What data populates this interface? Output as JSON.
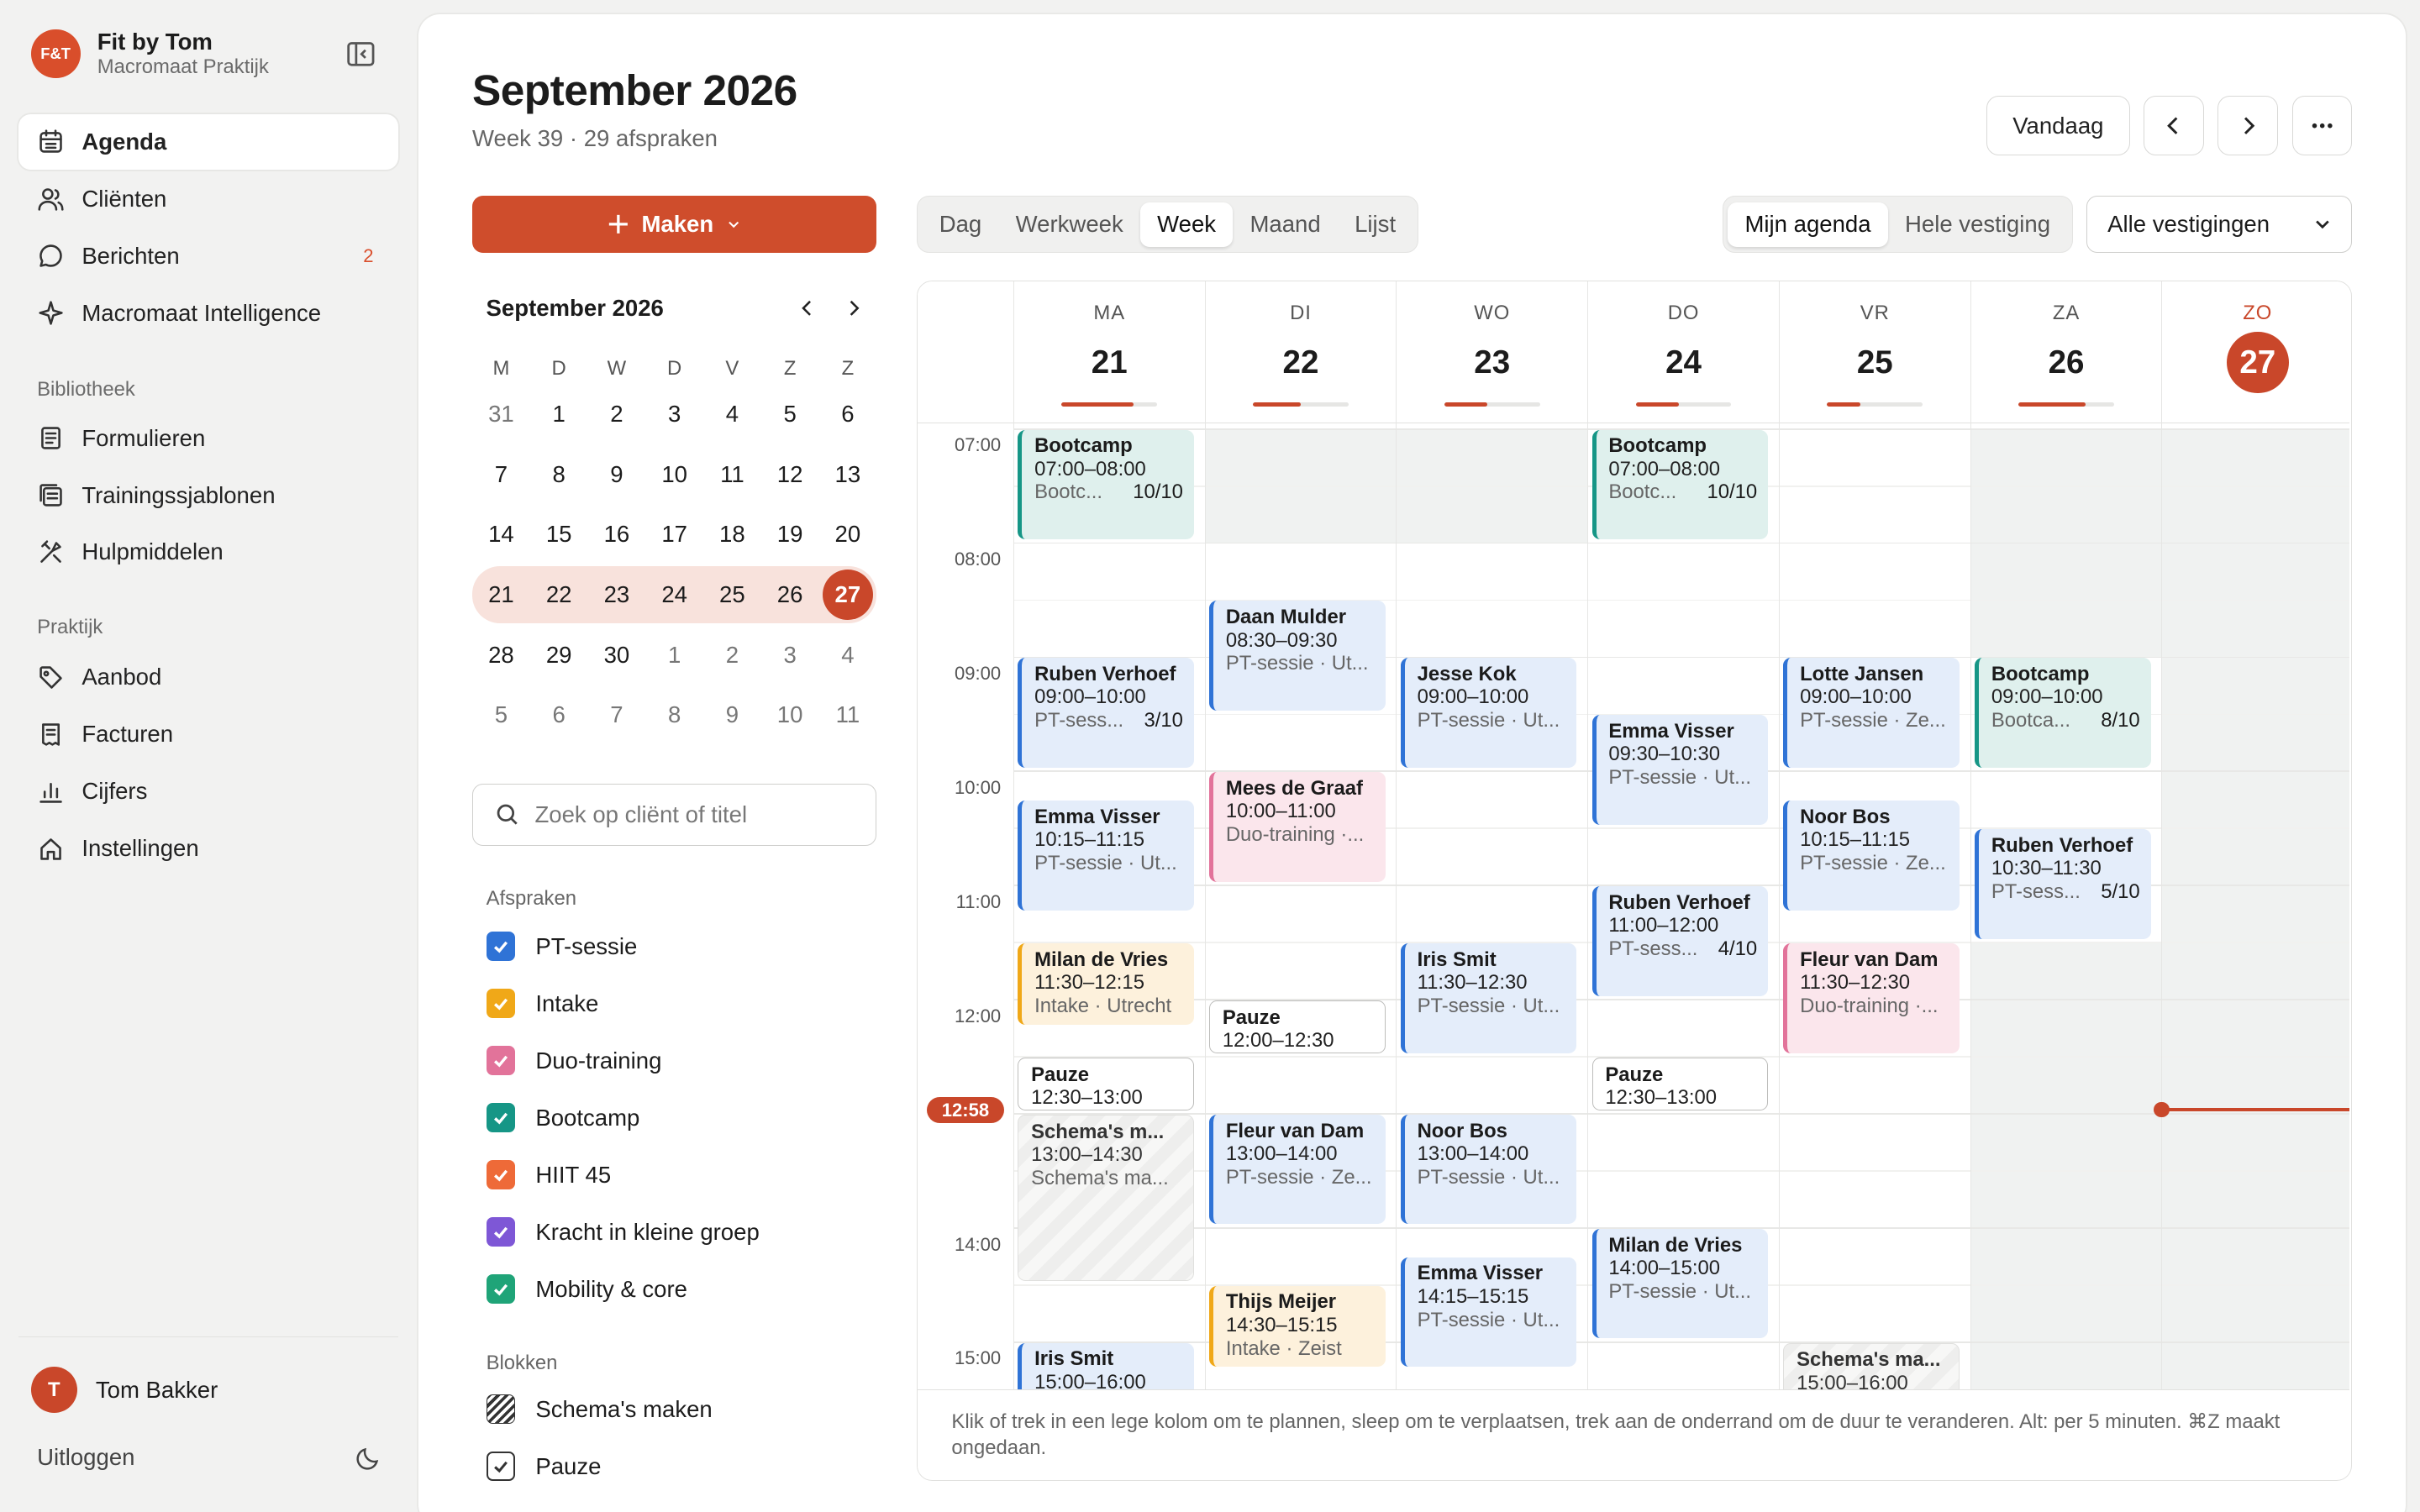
{
  "brand": {
    "logo_text": "F&T",
    "name": "Fit by Tom",
    "subtitle": "Macromaat Praktijk"
  },
  "nav": [
    {
      "label": "Agenda",
      "icon": "calendar-icon",
      "active": true
    },
    {
      "label": "Cliënten",
      "icon": "users-icon"
    },
    {
      "label": "Berichten",
      "icon": "message-icon",
      "badge": "2"
    },
    {
      "label": "Macromaat Intelligence",
      "icon": "sparkle-icon"
    }
  ],
  "section_library": "Bibliotheek",
  "nav_library": [
    {
      "label": "Formulieren",
      "icon": "form-icon"
    },
    {
      "label": "Trainingssjablonen",
      "icon": "template-icon"
    },
    {
      "label": "Hulpmiddelen",
      "icon": "tools-icon"
    }
  ],
  "section_practice": "Praktijk",
  "nav_practice": [
    {
      "label": "Aanbod",
      "icon": "tag-icon"
    },
    {
      "label": "Facturen",
      "icon": "invoice-icon"
    },
    {
      "label": "Cijfers",
      "icon": "chart-icon"
    },
    {
      "label": "Instellingen",
      "icon": "home-icon"
    }
  ],
  "user": {
    "initial": "T",
    "name": "Tom Bakker",
    "logout": "Uitloggen"
  },
  "header": {
    "title": "September 2026",
    "subtitle": "Week 39 · 29 afspraken",
    "today_label": "Vandaag"
  },
  "create_label": "Maken",
  "mini_calendar": {
    "title": "September 2026",
    "weekdays": [
      "M",
      "D",
      "W",
      "D",
      "V",
      "Z",
      "Z"
    ],
    "weeks": [
      [
        "31",
        "1",
        "2",
        "3",
        "4",
        "5",
        "6"
      ],
      [
        "7",
        "8",
        "9",
        "10",
        "11",
        "12",
        "13"
      ],
      [
        "14",
        "15",
        "16",
        "17",
        "18",
        "19",
        "20"
      ],
      [
        "21",
        "22",
        "23",
        "24",
        "25",
        "26",
        "27"
      ],
      [
        "28",
        "29",
        "30",
        "1",
        "2",
        "3",
        "4"
      ],
      [
        "5",
        "6",
        "7",
        "8",
        "9",
        "10",
        "11"
      ]
    ],
    "current_week": 3,
    "selected": "27"
  },
  "search_placeholder": "Zoek op cliënt of titel",
  "legend_appointments_title": "Afspraken",
  "legend_appointments": [
    {
      "label": "PT-sessie",
      "color": "#2f73d6"
    },
    {
      "label": "Intake",
      "color": "#f0a818"
    },
    {
      "label": "Duo-training",
      "color": "#e2739a"
    },
    {
      "label": "Bootcamp",
      "color": "#169686"
    },
    {
      "label": "HIIT 45",
      "color": "#ee6a38"
    },
    {
      "label": "Kracht in kleine groep",
      "color": "#7e57d6"
    },
    {
      "label": "Mobility & core",
      "color": "#1fa478"
    }
  ],
  "legend_blocks_title": "Blokken",
  "legend_blocks": [
    {
      "label": "Schema's maken",
      "style": "hatch"
    },
    {
      "label": "Pauze",
      "style": "outline"
    }
  ],
  "views": [
    "Dag",
    "Werkweek",
    "Week",
    "Maand",
    "Lijst"
  ],
  "active_view": "Week",
  "scopes": [
    "Mijn agenda",
    "Hele vestiging"
  ],
  "active_scope": "Mijn agenda",
  "location_select": "Alle vestigingen",
  "week": {
    "days": [
      {
        "dow": "MA",
        "num": "21",
        "load": 0.75
      },
      {
        "dow": "DI",
        "num": "22",
        "load": 0.5
      },
      {
        "dow": "WO",
        "num": "23",
        "load": 0.45
      },
      {
        "dow": "DO",
        "num": "24",
        "load": 0.45
      },
      {
        "dow": "VR",
        "num": "25",
        "load": 0.35
      },
      {
        "dow": "ZA",
        "num": "26",
        "load": 0.7
      },
      {
        "dow": "ZO",
        "num": "27",
        "today": true
      }
    ],
    "hours": [
      "07:00",
      "08:00",
      "09:00",
      "10:00",
      "11:00",
      "12:00",
      "14:00",
      "15:00"
    ],
    "now": "12:58",
    "events": [
      {
        "day": 0,
        "start": "07:00",
        "end": "08:00",
        "title": "Bootcamp",
        "time": "07:00–08:00",
        "sub": "Bootc...",
        "count": "10/10",
        "type": "boot"
      },
      {
        "day": 0,
        "start": "09:00",
        "end": "10:00",
        "title": "Ruben Verhoef",
        "time": "09:00–10:00",
        "sub": "PT-sess...",
        "count": "3/10",
        "type": "pt"
      },
      {
        "day": 0,
        "start": "10:15",
        "end": "11:15",
        "title": "Emma Visser",
        "time": "10:15–11:15",
        "sub": "PT-sessie · Ut...",
        "type": "pt"
      },
      {
        "day": 0,
        "start": "11:30",
        "end": "12:15",
        "title": "Milan de Vries",
        "time": "11:30–12:15",
        "sub": "Intake · Utrecht",
        "type": "intake"
      },
      {
        "day": 0,
        "start": "12:30",
        "end": "13:00",
        "title": "Pauze",
        "time": "12:30–13:00",
        "type": "pauze"
      },
      {
        "day": 0,
        "start": "13:00",
        "end": "14:30",
        "title": "Schema's m...",
        "time": "13:00–14:30",
        "sub": "Schema's ma...",
        "type": "schema"
      },
      {
        "day": 0,
        "start": "15:00",
        "end": "16:00",
        "title": "Iris Smit",
        "time": "15:00–16:00",
        "type": "pt"
      },
      {
        "day": 1,
        "start": "08:30",
        "end": "09:30",
        "title": "Daan Mulder",
        "time": "08:30–09:30",
        "sub": "PT-sessie · Ut...",
        "type": "pt"
      },
      {
        "day": 1,
        "start": "10:00",
        "end": "11:00",
        "title": "Mees de Graaf",
        "time": "10:00–11:00",
        "sub": "Duo-training ·...",
        "type": "duo"
      },
      {
        "day": 1,
        "start": "12:00",
        "end": "12:30",
        "title": "Pauze",
        "time": "12:00–12:30",
        "type": "pauze"
      },
      {
        "day": 1,
        "start": "13:00",
        "end": "14:00",
        "title": "Fleur van Dam",
        "time": "13:00–14:00",
        "sub": "PT-sessie · Ze...",
        "type": "pt"
      },
      {
        "day": 1,
        "start": "14:30",
        "end": "15:15",
        "title": "Thijs Meijer",
        "time": "14:30–15:15",
        "sub": "Intake · Zeist",
        "type": "intake"
      },
      {
        "day": 2,
        "start": "09:00",
        "end": "10:00",
        "title": "Jesse Kok",
        "time": "09:00–10:00",
        "sub": "PT-sessie · Ut...",
        "type": "pt"
      },
      {
        "day": 2,
        "start": "11:30",
        "end": "12:30",
        "title": "Iris Smit",
        "time": "11:30–12:30",
        "sub": "PT-sessie · Ut...",
        "type": "pt"
      },
      {
        "day": 2,
        "start": "13:00",
        "end": "14:00",
        "title": "Noor Bos",
        "time": "13:00–14:00",
        "sub": "PT-sessie · Ut...",
        "type": "pt"
      },
      {
        "day": 2,
        "start": "14:15",
        "end": "15:15",
        "title": "Emma Visser",
        "time": "14:15–15:15",
        "sub": "PT-sessie · Ut...",
        "type": "pt"
      },
      {
        "day": 3,
        "start": "07:00",
        "end": "08:00",
        "title": "Bootcamp",
        "time": "07:00–08:00",
        "sub": "Bootc...",
        "count": "10/10",
        "type": "boot"
      },
      {
        "day": 3,
        "start": "09:30",
        "end": "10:30",
        "title": "Emma Visser",
        "time": "09:30–10:30",
        "sub": "PT-sessie · Ut...",
        "type": "pt"
      },
      {
        "day": 3,
        "start": "11:00",
        "end": "12:00",
        "title": "Ruben Verhoef",
        "time": "11:00–12:00",
        "sub": "PT-sess...",
        "count": "4/10",
        "type": "pt"
      },
      {
        "day": 3,
        "start": "12:30",
        "end": "13:00",
        "title": "Pauze",
        "time": "12:30–13:00",
        "type": "pauze"
      },
      {
        "day": 3,
        "start": "14:00",
        "end": "15:00",
        "title": "Milan de Vries",
        "time": "14:00–15:00",
        "sub": "PT-sessie · Ut...",
        "type": "pt"
      },
      {
        "day": 4,
        "start": "09:00",
        "end": "10:00",
        "title": "Lotte Jansen",
        "time": "09:00–10:00",
        "sub": "PT-sessie · Ze...",
        "type": "pt"
      },
      {
        "day": 4,
        "start": "10:15",
        "end": "11:15",
        "title": "Noor Bos",
        "time": "10:15–11:15",
        "sub": "PT-sessie · Ze...",
        "type": "pt"
      },
      {
        "day": 4,
        "start": "11:30",
        "end": "12:30",
        "title": "Fleur van Dam",
        "time": "11:30–12:30",
        "sub": "Duo-training ·...",
        "type": "duo"
      },
      {
        "day": 4,
        "start": "15:00",
        "end": "16:00",
        "title": "Schema's ma...",
        "time": "15:00–16:00",
        "type": "schema"
      },
      {
        "day": 5,
        "start": "09:00",
        "end": "10:00",
        "title": "Bootcamp",
        "time": "09:00–10:00",
        "sub": "Bootca...",
        "count": "8/10",
        "type": "boot"
      },
      {
        "day": 5,
        "start": "10:30",
        "end": "11:30",
        "title": "Ruben Verhoef",
        "time": "10:30–11:30",
        "sub": "PT-sess...",
        "count": "5/10",
        "type": "pt"
      }
    ]
  },
  "hint": "Klik of trek in een lege kolom om te plannen, sleep om te verplaatsen, trek aan de onderrand om de duur te veranderen. Alt: per 5 minuten. ⌘Z maakt ongedaan."
}
